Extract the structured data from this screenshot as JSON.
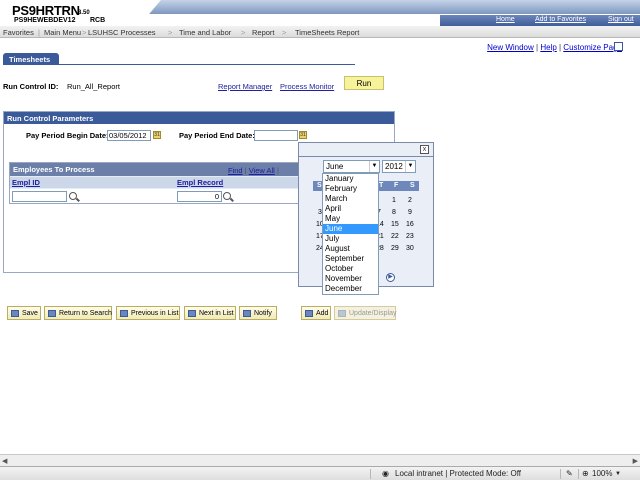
{
  "header": {
    "logo_main": "PS9HRTRN",
    "logo_version": "8.50",
    "logo_sub": "PS9HEWEBDEV12",
    "logo_user": "RCB",
    "links": [
      "Home",
      "Add to Favorites",
      "Sign out"
    ]
  },
  "menubar": [
    "Favorites",
    "Main Menu",
    "LSUHSC Processes",
    "Time and Labor",
    "Report",
    "TimeSheets Report"
  ],
  "top_links": {
    "new_window": "New Window",
    "help": "Help",
    "customize": "Customize Page"
  },
  "tab": "Timesheets",
  "run_control": {
    "label": "Run Control ID:",
    "value": "Run_All_Report",
    "report_manager": "Report Manager",
    "process_monitor": "Process Monitor",
    "run_button": "Run"
  },
  "params": {
    "title": "Run Control Parameters",
    "begin_label": "Pay Period Begin Date:",
    "begin_value": "03/05/2012",
    "end_label": "Pay Period End Date:",
    "end_value": ""
  },
  "employees": {
    "title": "Employees To Process",
    "find": "Find",
    "view_all": "View All",
    "columns": [
      "Empl ID",
      "Empl Record"
    ],
    "row": {
      "empl_id": "",
      "empl_record": "0"
    }
  },
  "calendar": {
    "close": "x",
    "month": "June",
    "year": "2012",
    "weekdays": [
      "S",
      "M",
      "T",
      "W",
      "T",
      "F",
      "S"
    ],
    "visible_days": [
      {
        "day": "1"
      },
      {
        "day": "2"
      },
      {
        "day": "3"
      },
      {
        "day": "7"
      },
      {
        "day": "8"
      },
      {
        "day": "9"
      },
      {
        "day": "10"
      },
      {
        "day": "14"
      },
      {
        "day": "15"
      },
      {
        "day": "16"
      },
      {
        "day": "17"
      },
      {
        "day": "21"
      },
      {
        "day": "22"
      },
      {
        "day": "23"
      },
      {
        "day": "24"
      },
      {
        "day": "28"
      },
      {
        "day": "29"
      },
      {
        "day": "30"
      }
    ],
    "months": [
      "January",
      "February",
      "March",
      "April",
      "May",
      "June",
      "July",
      "August",
      "September",
      "October",
      "November",
      "December"
    ],
    "selected_month": "June"
  },
  "buttons": [
    {
      "label": "Save",
      "name": "save-button",
      "disabled": false
    },
    {
      "label": "Return to Search",
      "name": "return-to-search-button",
      "disabled": false
    },
    {
      "label": "Previous in List",
      "name": "previous-in-list-button",
      "disabled": false
    },
    {
      "label": "Next in List",
      "name": "next-in-list-button",
      "disabled": false
    },
    {
      "label": "Notify",
      "name": "notify-button",
      "disabled": false
    },
    {
      "label": "Add",
      "name": "add-button",
      "disabled": false
    },
    {
      "label": "Update/Display",
      "name": "update-display-button",
      "disabled": true
    }
  ],
  "statusbar": {
    "zone": "Local intranet | Protected Mode: Off",
    "zoom": "100%"
  },
  "colors": {
    "header_blue": "#3a5a99",
    "run_button": "#f6f39a",
    "selected_item": "#3399ff"
  }
}
